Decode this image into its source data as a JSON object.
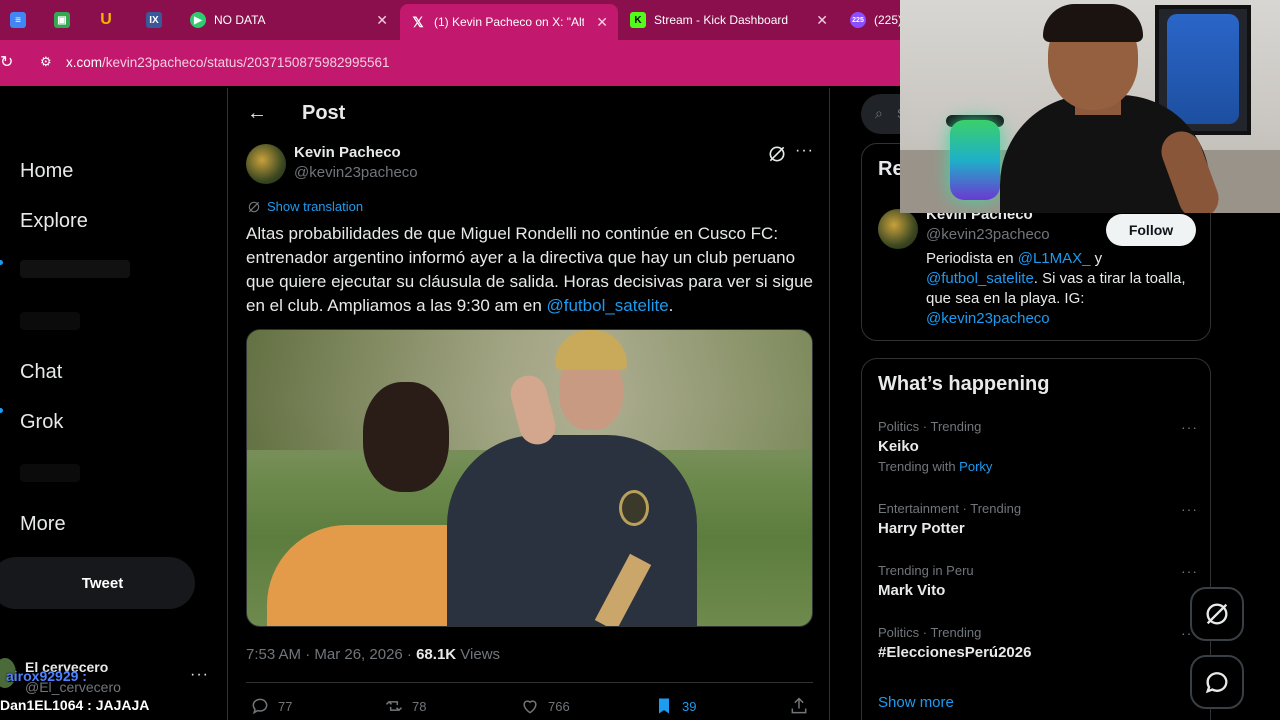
{
  "browser": {
    "tabs": [
      {
        "label": "",
        "icon": "docs-icon",
        "color": "#4285f4"
      },
      {
        "label": "",
        "icon": "extension-icon",
        "color": "#34a853"
      },
      {
        "label": "",
        "icon": "u-icon",
        "color": "#f4b400"
      },
      {
        "label": "",
        "icon": "ix-icon",
        "color": "#3b5998"
      },
      {
        "label": "NO DATA",
        "icon": "play-icon",
        "color": "#2ecc71"
      },
      {
        "label": "(1) Kevin Pacheco on X: \"Alt",
        "icon": "x-logo-icon",
        "color": "#000000"
      },
      {
        "label": "Stream - Kick Dashboard",
        "icon": "kick-icon",
        "color": "#53fc18"
      },
      {
        "label": "(225)",
        "icon": "badge-icon",
        "color": "#8a4fff"
      }
    ],
    "url_domain": "x.com",
    "url_path": "/kevin23pacheco/status/2037150875982995561"
  },
  "nav": {
    "items": [
      "Home",
      "Explore",
      "Chat",
      "Grok",
      "More"
    ],
    "tweet_label": "Tweet",
    "account_name": "El cervecero",
    "account_handle": "@El_cervecero"
  },
  "stream_chat": {
    "line1_user": "airox92929 :",
    "line2_user": "Dan1EL1064 :",
    "line2_msg": "JAJAJA"
  },
  "post": {
    "header_title": "Post",
    "author_name": "Kevin Pacheco",
    "author_handle": "@kevin23pacheco",
    "show_translation": "Show translation",
    "text_main": "Altas probabilidades de que Miguel Rondelli no continúe en Cusco FC: entrenador argentino informó ayer a la directiva que hay un club peruano que quiere ejecutar su cláusula de salida. Horas decisivas para ver si sigue en el club. Ampliamos a las 9:30 am en ",
    "text_mention": "@futbol_satelite",
    "text_end": ".",
    "time": "7:53 AM · Mar 26, 2026 · ",
    "views_count": "68.1K",
    "views_label": " Views",
    "replies": "77",
    "reposts": "78",
    "likes": "766",
    "bookmarks": "39"
  },
  "sidebar": {
    "search_placeholder": "S",
    "relevant_title": "Re",
    "relevant": {
      "name": "Kevin Pacheco",
      "handle": "@kevin23pacheco",
      "follow_label": "Follow",
      "bio_1": "Periodista en ",
      "bio_mention1": "@L1MAX_",
      "bio_2": " y ",
      "bio_mention2": "@futbol_satelite",
      "bio_3": ". Si vas a tirar la toalla, que sea en la playa. IG: ",
      "bio_mention3": "@kevin23pacheco"
    },
    "happening_title": "What’s happening",
    "trends": [
      {
        "category": "Politics · Trending",
        "topic": "Keiko",
        "with_label": "Trending with ",
        "with_link": "Porky"
      },
      {
        "category": "Entertainment · Trending",
        "topic": "Harry Potter"
      },
      {
        "category": "Trending in Peru",
        "topic": "Mark Vito"
      },
      {
        "category": "Politics · Trending",
        "topic": "#EleccionesPerú2026"
      }
    ],
    "show_more": "Show more"
  },
  "colors": {
    "accent": "#1d9bf0",
    "browser_frame": "#c2186d",
    "background": "#000000"
  }
}
